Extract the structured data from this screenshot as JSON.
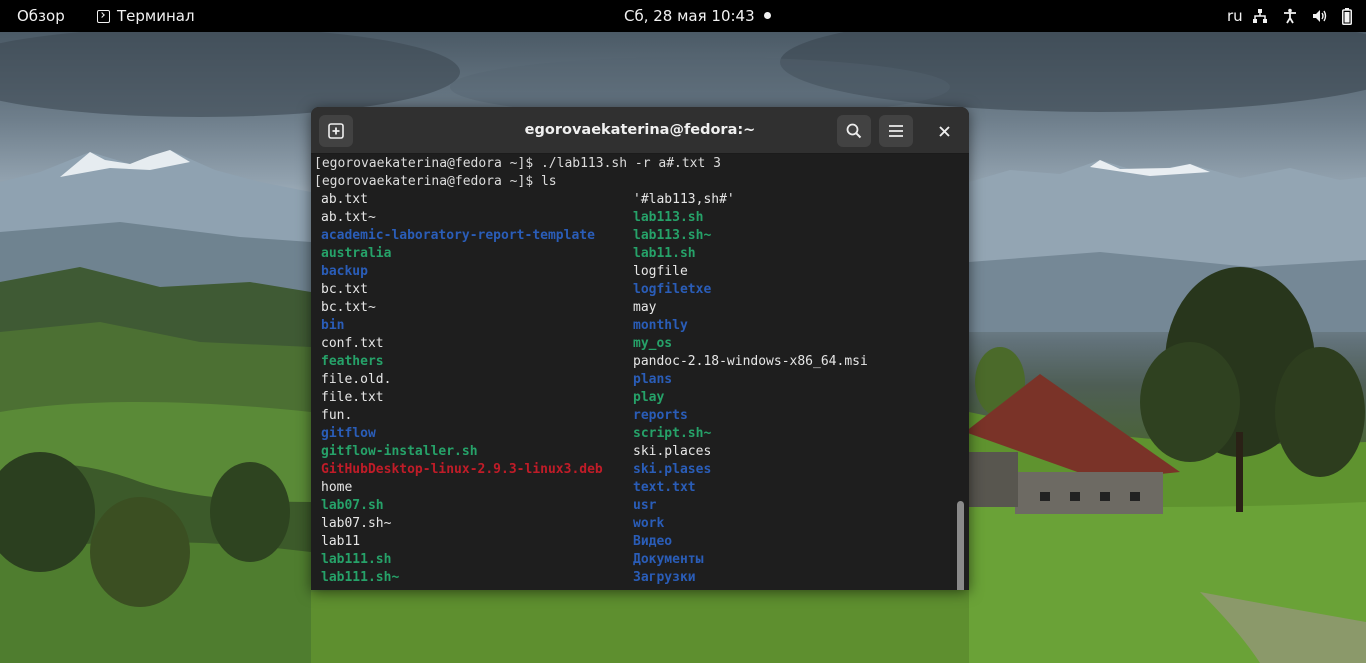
{
  "topbar": {
    "overview": "Обзор",
    "app_name": "Терминал",
    "clock": "Сб, 28 мая  10:43",
    "keyboard_layout": "ru"
  },
  "window": {
    "title": "egorovaekaterina@fedora:~"
  },
  "terminal": {
    "lines": [
      "[egorovaekaterina@fedora ~]$ ./lab113.sh -r a#.txt 3",
      "[egorovaekaterina@fedora ~]$ ls"
    ],
    "ls_col1": [
      {
        "name": "ab.txt",
        "type": "file"
      },
      {
        "name": "ab.txt~",
        "type": "file"
      },
      {
        "name": "academic-laboratory-report-template",
        "type": "dir"
      },
      {
        "name": "australia",
        "type": "exec"
      },
      {
        "name": "backup",
        "type": "dir"
      },
      {
        "name": "bc.txt",
        "type": "file"
      },
      {
        "name": "bc.txt~",
        "type": "file"
      },
      {
        "name": "bin",
        "type": "dir"
      },
      {
        "name": "conf.txt",
        "type": "file"
      },
      {
        "name": "feathers",
        "type": "exec"
      },
      {
        "name": "file.old.",
        "type": "file"
      },
      {
        "name": "file.txt",
        "type": "file"
      },
      {
        "name": "fun.",
        "type": "file"
      },
      {
        "name": "gitflow",
        "type": "dir"
      },
      {
        "name": "gitflow-installer.sh",
        "type": "exec"
      },
      {
        "name": "GitHubDesktop-linux-2.9.3-linux3.deb",
        "type": "archive"
      },
      {
        "name": "home",
        "type": "file"
      },
      {
        "name": "lab07.sh",
        "type": "exec"
      },
      {
        "name": "lab07.sh~",
        "type": "file"
      },
      {
        "name": "lab11",
        "type": "file"
      },
      {
        "name": "lab111.sh",
        "type": "exec"
      },
      {
        "name": "lab111.sh~",
        "type": "exec"
      }
    ],
    "ls_col2": [
      {
        "name": "'#lab113,sh#'",
        "type": "file"
      },
      {
        "name": "lab113.sh",
        "type": "exec"
      },
      {
        "name": "lab113.sh~",
        "type": "exec"
      },
      {
        "name": "lab11.sh",
        "type": "exec"
      },
      {
        "name": "logfile",
        "type": "file"
      },
      {
        "name": "logfiletxe",
        "type": "dir"
      },
      {
        "name": "may",
        "type": "file"
      },
      {
        "name": "monthly",
        "type": "dir"
      },
      {
        "name": "my_os",
        "type": "exec"
      },
      {
        "name": "pandoc-2.18-windows-x86_64.msi",
        "type": "file"
      },
      {
        "name": "plans",
        "type": "dir"
      },
      {
        "name": "play",
        "type": "exec"
      },
      {
        "name": "reports",
        "type": "dir"
      },
      {
        "name": "script.sh~",
        "type": "exec"
      },
      {
        "name": "ski.places",
        "type": "file"
      },
      {
        "name": "ski.plases",
        "type": "dir"
      },
      {
        "name": "text.txt",
        "type": "dir"
      },
      {
        "name": "usr",
        "type": "dir"
      },
      {
        "name": "work",
        "type": "dir"
      },
      {
        "name": "Видео",
        "type": "dir"
      },
      {
        "name": "Документы",
        "type": "dir"
      },
      {
        "name": "Загрузки",
        "type": "dir"
      }
    ]
  },
  "icons": {
    "new_tab": "new-tab-icon",
    "search": "search-icon",
    "menu": "hamburger-menu-icon",
    "close": "close-icon",
    "network": "network-icon",
    "accessibility": "accessibility-icon",
    "volume": "volume-icon",
    "battery": "battery-icon"
  },
  "colors": {
    "directory": "#2a5db8",
    "executable": "#26a269",
    "archive": "#c01c28",
    "file": "#e6e6e6",
    "terminal_bg": "#1e1e1e",
    "headerbar_bg": "#303030"
  }
}
